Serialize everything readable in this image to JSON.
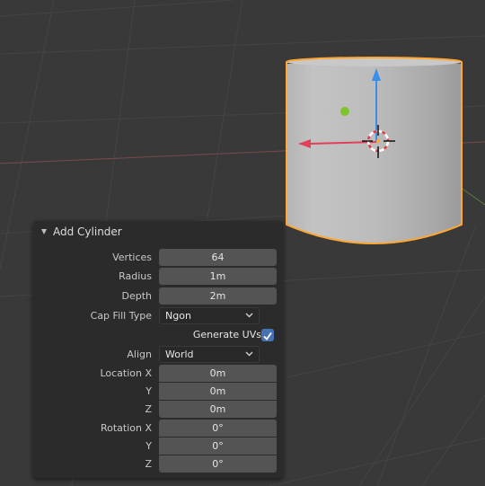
{
  "panel": {
    "title": "Add Cylinder",
    "vertices": {
      "label": "Vertices",
      "value": "64"
    },
    "radius": {
      "label": "Radius",
      "value": "1m"
    },
    "depth": {
      "label": "Depth",
      "value": "2m"
    },
    "cap_fill": {
      "label": "Cap Fill Type",
      "value": "Ngon"
    },
    "generate_uvs": {
      "label": "Generate UVs",
      "checked": true
    },
    "align": {
      "label": "Align",
      "value": "World"
    },
    "location": {
      "x_label": "Location X",
      "y_label": "Y",
      "z_label": "Z",
      "x": "0m",
      "y": "0m",
      "z": "0m"
    },
    "rotation": {
      "x_label": "Rotation X",
      "y_label": "Y",
      "z_label": "Z",
      "x": "0°",
      "y": "0°",
      "z": "0°"
    }
  },
  "icons": {
    "panel_collapse": "triangle-down-icon",
    "dropdown": "chevron-down-icon",
    "checkbox": "checkmark-icon",
    "cursor": "3d-cursor-icon",
    "gizmo": "transform-arrows-icon"
  },
  "colors": {
    "viewport_bg": "#393939",
    "selection_outline": "#ffa733",
    "axis_x": "#e0405a",
    "axis_y": "#7fc32f",
    "axis_z": "#3a8eea",
    "checkbox_accent": "#4772b3"
  }
}
